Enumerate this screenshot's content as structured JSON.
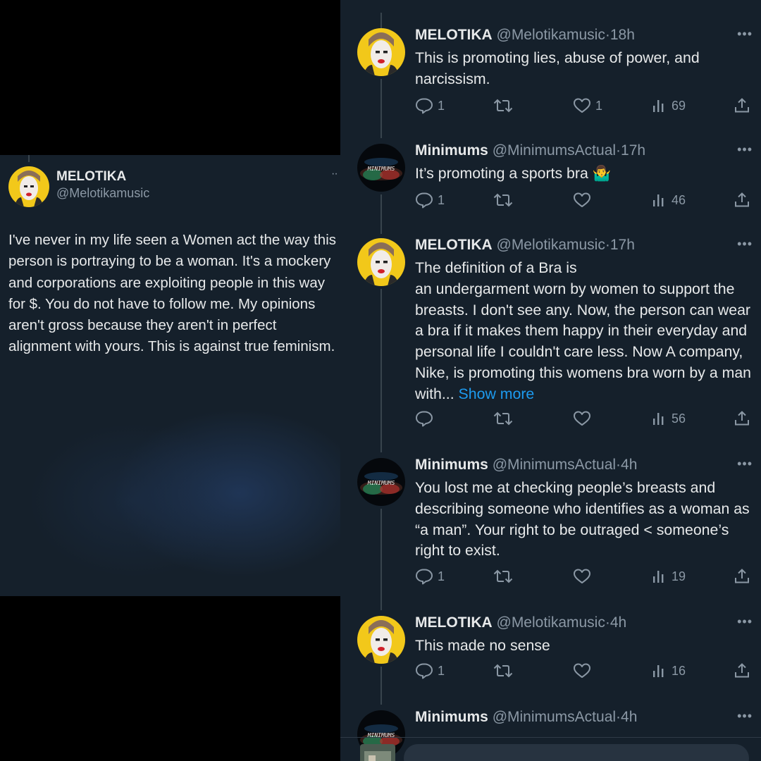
{
  "left": {
    "author": {
      "name": "MELOTIKA",
      "handle": "@Melotikamusic"
    },
    "more_icon": "ellipsis-icon",
    "body": "I've never in my life seen a Women act the way this person is portraying to be a woman. It's a mockery and corporations are exploiting people in this way for $. You do not have to follow me. My opinions aren't gross because they aren't in perfect alignment with yours. This is against true feminism."
  },
  "tweets": [
    {
      "name": "MELOTIKA",
      "handle": "@Melotikamusic",
      "dot": "·",
      "time": "18h",
      "body": "This is promoting lies, abuse of power, and narcissism.",
      "replies": "1",
      "retweets": "",
      "likes": "1",
      "views": "69"
    },
    {
      "name": "Minimums",
      "handle": "@MinimumsActual",
      "dot": "·",
      "time": "17h",
      "body": "It’s promoting a sports bra 🤷‍♂️",
      "replies": "1",
      "retweets": "",
      "likes": "",
      "views": "46"
    },
    {
      "name": "MELOTIKA",
      "handle": "@Melotikamusic",
      "dot": "·",
      "time": "17h",
      "body": "The definition of a Bra is\nan undergarment worn by women to support the breasts. I don't see any. Now, the person can wear a bra if it makes them happy in their everyday and personal life I couldn't care less. Now A company, Nike, is promoting this womens bra worn by a man with...",
      "show_more": "Show more",
      "replies": "",
      "retweets": "",
      "likes": "",
      "views": "56"
    },
    {
      "name": "Minimums",
      "handle": "@MinimumsActual",
      "dot": "·",
      "time": "4h",
      "body": "You lost me at checking people’s breasts and describing  someone who identifies as a woman as “a man”. Your right to be outraged < someone’s right to exist.",
      "replies": "1",
      "retweets": "",
      "likes": "",
      "views": "19"
    },
    {
      "name": "MELOTIKA",
      "handle": "@Melotikamusic",
      "dot": "·",
      "time": "4h",
      "body": "This made no sense",
      "replies": "1",
      "retweets": "",
      "likes": "",
      "views": "16"
    },
    {
      "name": "Minimums",
      "handle": "@MinimumsActual",
      "dot": "·",
      "time": "4h",
      "body": ""
    }
  ],
  "avatar_logo_text": "MINIMUMS",
  "icons": {
    "reply": "reply-icon",
    "retweet": "retweet-icon",
    "like": "heart-icon",
    "views": "views-icon",
    "share": "share-icon",
    "more": "ellipsis-icon"
  },
  "colors": {
    "background": "#15202b",
    "text": "#e7e9ea",
    "muted": "#8b98a5",
    "link": "#1d9bf0",
    "outer": "#000000"
  }
}
